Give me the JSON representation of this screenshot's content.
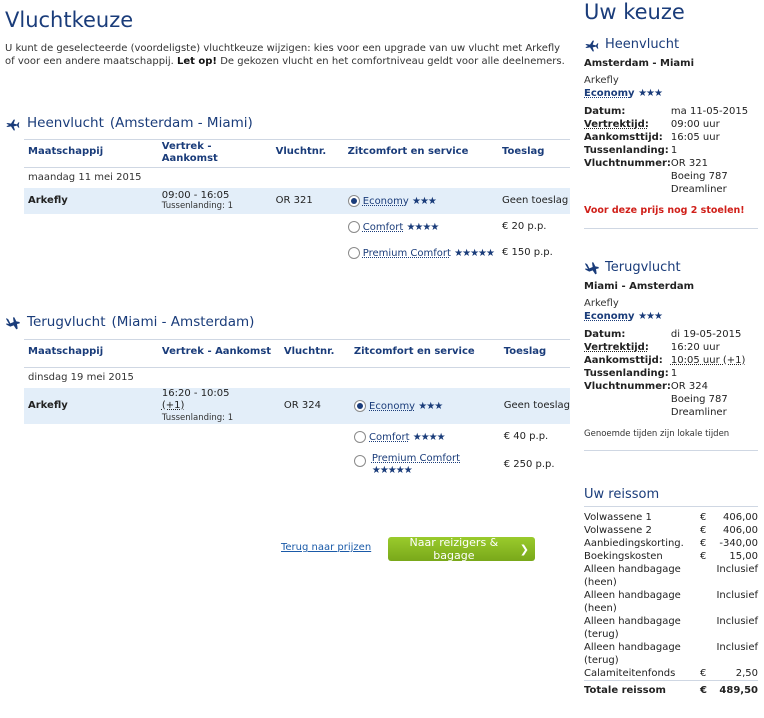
{
  "main": {
    "title": "Vluchtkeuze",
    "intro": "U kunt de geselecteerde (voordeligste) vluchtkeuze wijzigen: kies voor een upgrade van uw vlucht met Arkefly of voor een andere maatschappij.",
    "intro_bold": "Let op!",
    "intro_rest": "De gekozen vlucht en het comfortniveau geldt voor alle deelnemers."
  },
  "outbound": {
    "heading": "Heenvlucht",
    "route": "(Amsterdam - Miami)",
    "cols": {
      "airline": "Maatschappij",
      "times": "Vertrek - Aankomst",
      "flight": "Vluchtnr.",
      "comfort": "Zitcomfort en service",
      "surcharge": "Toeslag"
    },
    "date": "maandag 11 mei 2015",
    "airline": "Arkefly",
    "time": "09:00 - 16:05",
    "stopover": "Tussenlanding: 1",
    "flight_no": "OR 321",
    "options": [
      {
        "label": "Economy",
        "stars": "★★★",
        "price": "Geen toeslag",
        "selected": true
      },
      {
        "label": "Comfort",
        "stars": "★★★★",
        "price": "€ 20 p.p.",
        "selected": false
      },
      {
        "label": "Premium Comfort",
        "stars": "★★★★★",
        "price": "€ 150 p.p.",
        "selected": false
      }
    ]
  },
  "inbound": {
    "heading": "Terugvlucht",
    "route": "(Miami - Amsterdam)",
    "cols": {
      "airline": "Maatschappij",
      "times": "Vertrek - Aankomst",
      "flight": "Vluchtnr.",
      "comfort": "Zitcomfort en service",
      "surcharge": "Toeslag"
    },
    "date": "dinsdag 19 mei 2015",
    "airline": "Arkefly",
    "time": "16:20 - 10:05",
    "time_extra": "(+1)",
    "stopover": "Tussenlanding: 1",
    "flight_no": "OR 324",
    "options": [
      {
        "label": "Economy",
        "stars": "★★★",
        "price": "Geen toeslag",
        "selected": true
      },
      {
        "label": "Comfort",
        "stars": "★★★★",
        "price": "€ 40 p.p.",
        "selected": false
      },
      {
        "label": "Premium Comfort",
        "stars": "★★★★★",
        "price": "€ 250 p.p.",
        "selected": false
      }
    ]
  },
  "actions": {
    "back": "Terug naar prijzen",
    "next": "Naar reizigers & bagage",
    "next_arrow": "❯"
  },
  "summary": {
    "title": "Uw keuze",
    "heen": {
      "heading": "Heenvlucht",
      "route": "Amsterdam - Miami",
      "airline": "Arkefly",
      "class": "Economy",
      "stars": "★★★",
      "datum_k": "Datum:",
      "datum_v": "ma 11-05-2015",
      "vertrek_k": "Vertrektijd:",
      "vertrek_v": "09:00 uur",
      "aankomst_k": "Aankomsttijd:",
      "aankomst_v": "16:05 uur",
      "tussen_k": "Tussenlanding:",
      "tussen_v": "1",
      "nr_k": "Vluchtnummer:",
      "nr_v": "OR 321",
      "aircraft": "Boeing 787 Dreamliner",
      "warning": "Voor deze prijs nog 2 stoelen!"
    },
    "terug": {
      "heading": "Terugvlucht",
      "route": "Miami - Amsterdam",
      "airline": "Arkefly",
      "class": "Economy",
      "stars": "★★★",
      "datum_k": "Datum:",
      "datum_v": "di 19-05-2015",
      "vertrek_k": "Vertrektijd:",
      "vertrek_v": "16:20 uur",
      "aankomst_k": "Aankomsttijd:",
      "aankomst_v": "10:05 uur (+1)",
      "tussen_k": "Tussenlanding:",
      "tussen_v": "1",
      "nr_k": "Vluchtnummer:",
      "nr_v": "OR 324",
      "aircraft": "Boeing 787 Dreamliner"
    },
    "local_note": "Genoemde tijden zijn lokale tijden",
    "trip_title": "Uw reissom",
    "costs": [
      {
        "label": "Volwassene 1",
        "cur": "€",
        "amount": "406,00"
      },
      {
        "label": "Volwassene 2",
        "cur": "€",
        "amount": "406,00"
      },
      {
        "label": "Aanbiedingskorting.",
        "cur": "€",
        "amount": "-340,00"
      },
      {
        "label": "Boekingskosten",
        "cur": "€",
        "amount": "15,00"
      },
      {
        "label": "Alleen handbagage (heen)",
        "cur": "",
        "amount": "Inclusief"
      },
      {
        "label": "Alleen handbagage (heen)",
        "cur": "",
        "amount": "Inclusief"
      },
      {
        "label": "Alleen handbagage (terug)",
        "cur": "",
        "amount": "Inclusief"
      },
      {
        "label": "Alleen handbagage (terug)",
        "cur": "",
        "amount": "Inclusief"
      },
      {
        "label": "Calamiteitenfonds",
        "cur": "€",
        "amount": "2,50"
      }
    ],
    "total_label": "Totale reissom",
    "total_cur": "€",
    "total_amount": "489,50"
  }
}
